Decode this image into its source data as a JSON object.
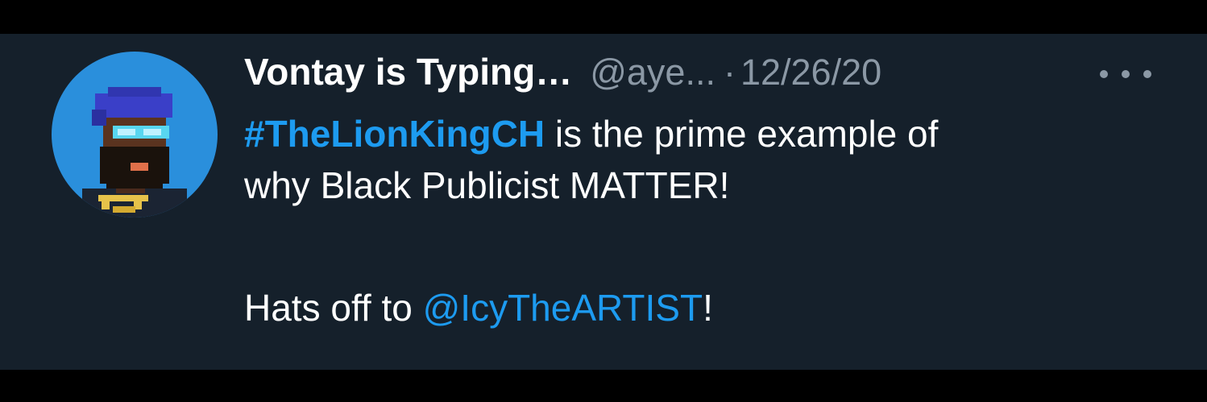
{
  "tweet": {
    "display_name": "Vontay is Typing…",
    "handle": "@aye...",
    "separator": "·",
    "timestamp": "12/26/20",
    "more_icon": "more-horizontal-icon",
    "hashtag": "#TheLionKingCH",
    "line1_rest": " is the prime example of",
    "line2": "why Black Publicist MATTER!",
    "line3_prefix": "Hats off to ",
    "mention": "@IcyTheARTIST",
    "line3_suffix": "!"
  },
  "colors": {
    "background": "#15202b",
    "link": "#1d9bf0",
    "secondary_text": "#8b98a5",
    "avatar_background": "#2a8fdc"
  }
}
